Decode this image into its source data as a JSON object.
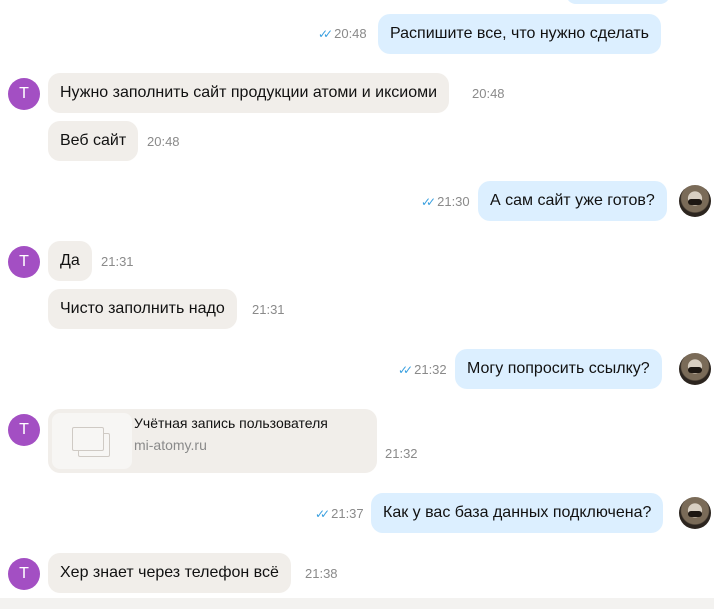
{
  "messages": [
    {
      "text": "Распишите все, что нужно сделать",
      "time": "20:48",
      "ticks": "✓✓"
    },
    {
      "text": "Нужно заполнить сайт продукции атоми и иксиоми",
      "time": "20:48",
      "avatar": "Т"
    },
    {
      "text": "Веб сайт",
      "time": "20:48"
    },
    {
      "text": "А сам сайт уже готов?",
      "time": "21:30",
      "ticks": "✓✓"
    },
    {
      "text": "Да",
      "time": "21:31",
      "avatar": "Т"
    },
    {
      "text": "Чисто заполнить надо",
      "time": "21:31"
    },
    {
      "text": "Могу попросить ссылку?",
      "time": "21:32",
      "ticks": "✓✓"
    },
    {
      "link_title": "Учётная запись пользователя",
      "link_url": "mi-atomy.ru",
      "time": "21:32",
      "avatar": "Т"
    },
    {
      "text": "Как у вас база данных подключена?",
      "time": "21:37",
      "ticks": "✓✓"
    },
    {
      "text": "Хер знает через телефон всё",
      "time": "21:38",
      "avatar": "Т"
    }
  ],
  "colors": {
    "outgoing_bubble": "#dcefff",
    "incoming_bubble": "#f1eeea",
    "avatar_t": "#a34fc3",
    "read_ticks": "#3aa0e0"
  }
}
